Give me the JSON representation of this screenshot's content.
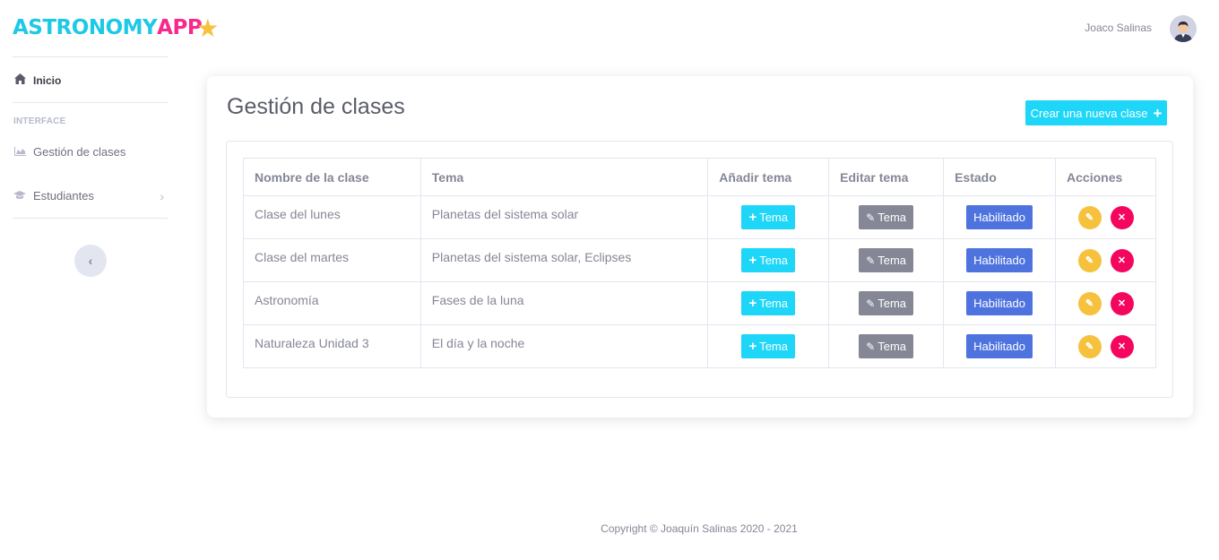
{
  "brand": {
    "part1": "ASTRONOMY",
    "part2": "APP",
    "star": "★"
  },
  "sidebar": {
    "home_label": "Inicio",
    "heading": "INTERFACE",
    "items": [
      {
        "label": "Gestión de clases",
        "icon": "chart-area-icon"
      },
      {
        "label": "Estudiantes",
        "icon": "graduation-cap-icon"
      }
    ],
    "toggle_glyph": "‹"
  },
  "topbar": {
    "user_name": "Joaco Salinas"
  },
  "card": {
    "title": "Gestión de clases",
    "new_button": "Crear una nueva clase",
    "new_button_glyph": "+"
  },
  "table": {
    "headers": [
      "Nombre de la clase",
      "Tema",
      "Añadir tema",
      "Editar tema",
      "Estado",
      "Acciones"
    ],
    "rows": [
      {
        "name": "Clase del lunes",
        "tema": "Planetas del sistema solar",
        "add": "Tema",
        "edit": "Tema",
        "estado": "Habilitado"
      },
      {
        "name": "Clase del martes",
        "tema": "Planetas del sistema solar, Eclipses",
        "add": "Tema",
        "edit": "Tema",
        "estado": "Habilitado"
      },
      {
        "name": "Astronomía",
        "tema": "Fases de la luna",
        "add": "Tema",
        "edit": "Tema",
        "estado": "Habilitado"
      },
      {
        "name": "Naturaleza Unidad 3",
        "tema": "El día y la noche",
        "add": "Tema",
        "edit": "Tema",
        "estado": "Habilitado"
      }
    ]
  },
  "footer": {
    "copyright": "Copyright © Joaquín Salinas 2020 - 2021"
  },
  "colors": {
    "accent_cyan": "#1ed6f7",
    "primary_blue": "#4e73df",
    "secondary_gray": "#858796",
    "warning_yellow": "#f6c23e",
    "danger_pink": "#f5065e"
  }
}
